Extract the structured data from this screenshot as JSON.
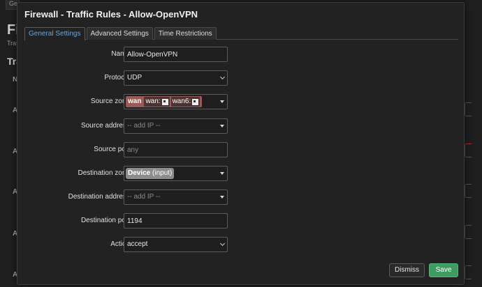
{
  "modal": {
    "title": "Firewall - Traffic Rules - Allow-OpenVPN"
  },
  "tabs": [
    {
      "label": "General Settings",
      "active": true
    },
    {
      "label": "Advanced Settings",
      "active": false
    },
    {
      "label": "Time Restrictions",
      "active": false
    }
  ],
  "form": {
    "name": {
      "label": "Name",
      "value": "Allow-OpenVPN"
    },
    "protocol": {
      "label": "Protocol",
      "value": "UDP"
    },
    "source_zone": {
      "label": "Source zone",
      "zone": "wan",
      "networks": [
        "wan:",
        "wan6:"
      ]
    },
    "source_address": {
      "label": "Source address",
      "placeholder": "-- add IP --"
    },
    "source_port": {
      "label": "Source port",
      "placeholder": "any"
    },
    "destination_zone": {
      "label": "Destination zone",
      "zone": "Device",
      "zone_detail": "(input)"
    },
    "destination_address": {
      "label": "Destination address",
      "placeholder": "-- add IP --"
    },
    "destination_port": {
      "label": "Destination port",
      "value": "1194"
    },
    "action": {
      "label": "Action",
      "value": "accept"
    }
  },
  "buttons": {
    "dismiss": "Dismiss",
    "save": "Save"
  },
  "colors": {
    "accent_tab": "#6aa6de",
    "save_green": "#3e9b62",
    "wan_zone": "#9b5a56",
    "device_zone": "#8c8c8c"
  }
}
